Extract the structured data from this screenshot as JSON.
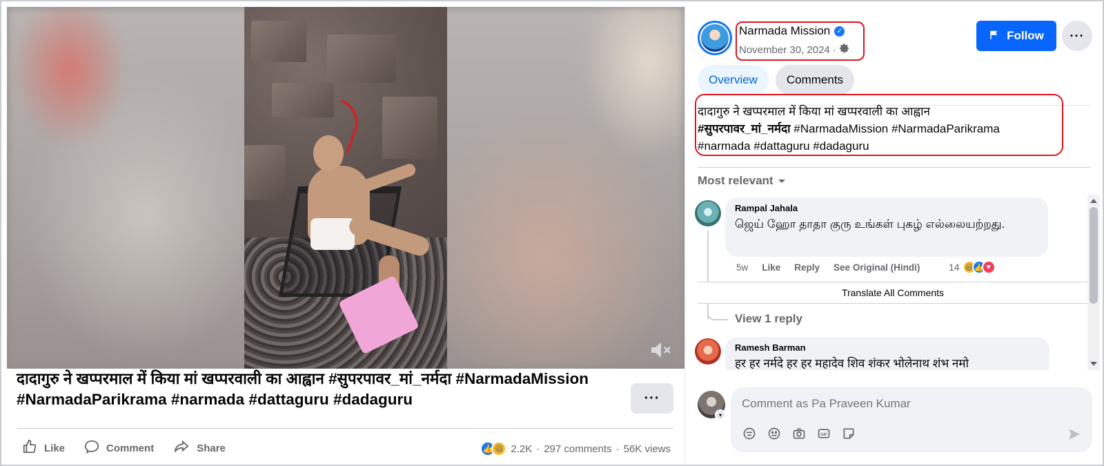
{
  "post": {
    "title": "दादागुरु ने खप्परमाल में किया मां खप्परवाली का आह्वान #सुपरपावर_मां_नर्मदा #NarmadaMission #NarmadaParikrama #narmada #dattaguru #dadaguru",
    "more_label": "···",
    "actions": {
      "like": "Like",
      "comment": "Comment",
      "share": "Share"
    },
    "stats": {
      "reactions": "2.2K",
      "comments": "297 comments",
      "views": "56K views",
      "dot": "·"
    }
  },
  "page": {
    "name": "Narmada Mission",
    "verified_mark": "✓",
    "date": "November 30, 2024",
    "date_sep": "·",
    "follow_label": "Follow",
    "more_label": "···"
  },
  "tabs": [
    {
      "label": "Overview",
      "active": true
    },
    {
      "label": "Comments",
      "active": false
    }
  ],
  "description": {
    "line1": "दादागुरु ने खप्परमाल में किया मां खप्परवाली का आह्वान",
    "bold_tag": "#सुपरपावर_मां_नर्मदा",
    "line2_rest": " #NarmadaMission #NarmadaParikrama",
    "line3": "#narmada #dattaguru #dadaguru"
  },
  "sort_label": "Most relevant",
  "comments": [
    {
      "name": "Rampal Jahala",
      "text": "ஜெய் ஹோ தாதா குரு உங்கள் புகழ் எல்லையற்றது.",
      "time": "5w",
      "like": "Like",
      "reply": "Reply",
      "see_original": "See Original (Hindi)",
      "reaction_count": "14"
    },
    {
      "name": "Ramesh Barman",
      "text": "हर हर नर्मदे हर हर महादेव शिव शंकर भोलेनाथ शंभ नमो"
    }
  ],
  "translate_all": "Translate All Comments",
  "view_reply": "View 1 reply",
  "composer": {
    "placeholder": "Comment as Pa Praveen Kumar"
  },
  "colors": {
    "accent": "#0866ff",
    "highlight_box": "#e0131c"
  }
}
